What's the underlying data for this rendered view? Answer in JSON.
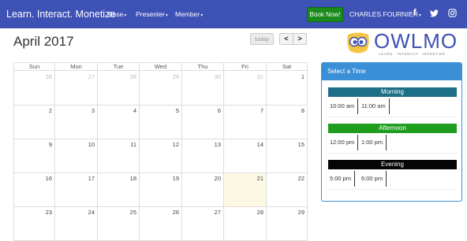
{
  "navbar": {
    "brand": "Learn. Interact. Monetize",
    "items": [
      {
        "label": "Base"
      },
      {
        "label": "Presenter"
      },
      {
        "label": "Member"
      }
    ],
    "book_label": "Book Now!",
    "user_label": "CHARLES FOURNIER",
    "social": [
      "f",
      "t",
      "ig"
    ]
  },
  "calendar": {
    "title": "April 2017",
    "today_label": "today",
    "prev_label": "<",
    "next_label": ">",
    "days_of_week": [
      "Sun",
      "Mon",
      "Tue",
      "Wed",
      "Thu",
      "Fri",
      "Sat"
    ],
    "weeks": [
      [
        "26",
        "27",
        "28",
        "29",
        "30",
        "31",
        "1"
      ],
      [
        "2",
        "3",
        "4",
        "5",
        "6",
        "7",
        "8"
      ],
      [
        "9",
        "10",
        "11",
        "12",
        "13",
        "14",
        "15"
      ],
      [
        "16",
        "17",
        "18",
        "19",
        "20",
        "21",
        "22"
      ],
      [
        "23",
        "24",
        "25",
        "26",
        "27",
        "28",
        "29"
      ]
    ],
    "other_month_cells": [
      [
        0,
        0
      ],
      [
        0,
        1
      ],
      [
        0,
        2
      ],
      [
        0,
        3
      ],
      [
        0,
        4
      ],
      [
        0,
        5
      ]
    ],
    "today_cell": [
      3,
      5
    ]
  },
  "logo": {
    "name": "OWLMO",
    "tagline": "LEARN . INTERACT . MONETIZE"
  },
  "time_panel": {
    "title": "Select a Time",
    "periods": [
      {
        "label": "Morning",
        "slots": [
          "10:00 am",
          "11:00 am"
        ]
      },
      {
        "label": "Afternoon",
        "slots": [
          "12:00 pm",
          "1:00 pm"
        ]
      },
      {
        "label": "Evening",
        "slots": [
          "5:00 pm",
          "6:00 pm"
        ]
      }
    ]
  },
  "colors": {
    "navbar": "#3e51b5",
    "book_button": "#1a8a1a",
    "panel_header": "#3a8fd6",
    "morning": "#1c6f86",
    "afternoon": "#1f9d1f",
    "evening": "#050505",
    "today_highlight": "#fcf8e3"
  }
}
